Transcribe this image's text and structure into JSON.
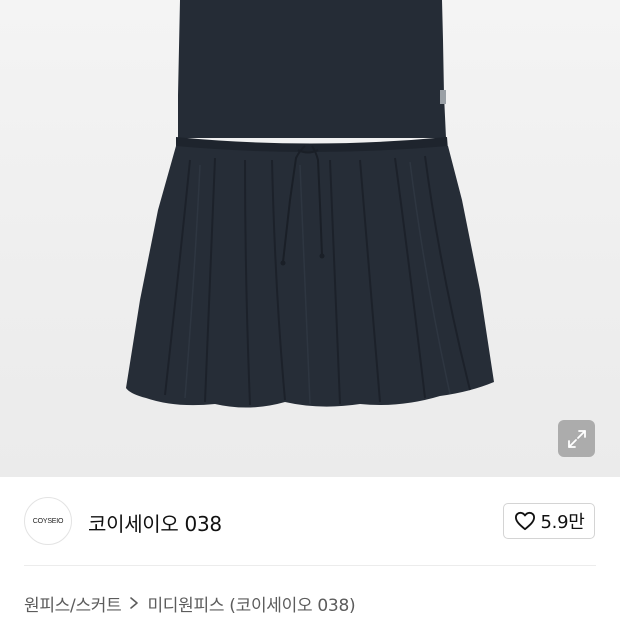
{
  "product": {
    "image_alt": "",
    "colors": {
      "dress": "#252c36",
      "background": "#eeeeee"
    }
  },
  "viewer": {
    "expand_icon": "expand-arrows-icon"
  },
  "brand": {
    "logo_text": "COYSEIO",
    "name": "코이세이오 038",
    "like_icon": "heart-outline-icon",
    "like_count": "5.9만"
  },
  "breadcrumb": {
    "items": [
      "원피스/스커트",
      "미디원피스 (코이세이오 038)"
    ],
    "separator_icon": "chevron-right-icon"
  }
}
